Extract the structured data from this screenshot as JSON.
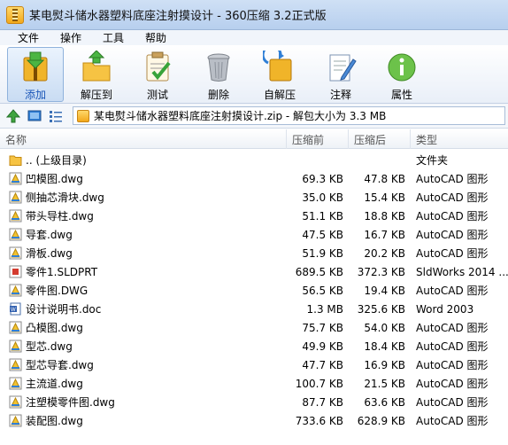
{
  "window": {
    "title": "某电熨斗储水器塑料底座注射摸设计 - 360压缩 3.2正式版"
  },
  "menu": [
    "文件",
    "操作",
    "工具",
    "帮助"
  ],
  "toolbar": {
    "add": "添加",
    "extract": "解压到",
    "test": "测试",
    "delete": "删除",
    "sfx": "自解压",
    "comment": "注释",
    "properties": "属性"
  },
  "address": {
    "path": "某电熨斗储水器塑料底座注射摸设计.zip - 解包大小为 3.3 MB"
  },
  "columns": {
    "name": "名称",
    "compressed": "压缩前",
    "packed": "压缩后",
    "type": "类型"
  },
  "files": [
    {
      "name": ".. (上级目录)",
      "compressed": "",
      "packed": "",
      "type": "文件夹",
      "icon": "folder-icon"
    },
    {
      "name": "凹模图.dwg",
      "compressed": "69.3 KB",
      "packed": "47.8 KB",
      "type": "AutoCAD 图形",
      "icon": "dwg-icon"
    },
    {
      "name": "侧抽芯滑块.dwg",
      "compressed": "35.0 KB",
      "packed": "15.4 KB",
      "type": "AutoCAD 图形",
      "icon": "dwg-icon"
    },
    {
      "name": "带头导柱.dwg",
      "compressed": "51.1 KB",
      "packed": "18.8 KB",
      "type": "AutoCAD 图形",
      "icon": "dwg-icon"
    },
    {
      "name": "导套.dwg",
      "compressed": "47.5 KB",
      "packed": "16.7 KB",
      "type": "AutoCAD 图形",
      "icon": "dwg-icon"
    },
    {
      "name": "滑板.dwg",
      "compressed": "51.9 KB",
      "packed": "20.2 KB",
      "type": "AutoCAD 图形",
      "icon": "dwg-icon"
    },
    {
      "name": "零件1.SLDPRT",
      "compressed": "689.5 KB",
      "packed": "372.3 KB",
      "type": "SldWorks 2014 ...",
      "icon": "sldprt-icon"
    },
    {
      "name": "零件图.DWG",
      "compressed": "56.5 KB",
      "packed": "19.4 KB",
      "type": "AutoCAD 图形",
      "icon": "dwg-icon"
    },
    {
      "name": "设计说明书.doc",
      "compressed": "1.3 MB",
      "packed": "325.6 KB",
      "type": "Word 2003",
      "icon": "doc-icon"
    },
    {
      "name": "凸模图.dwg",
      "compressed": "75.7 KB",
      "packed": "54.0 KB",
      "type": "AutoCAD 图形",
      "icon": "dwg-icon"
    },
    {
      "name": "型芯.dwg",
      "compressed": "49.9 KB",
      "packed": "18.4 KB",
      "type": "AutoCAD 图形",
      "icon": "dwg-icon"
    },
    {
      "name": "型芯导套.dwg",
      "compressed": "47.7 KB",
      "packed": "16.9 KB",
      "type": "AutoCAD 图形",
      "icon": "dwg-icon"
    },
    {
      "name": "主流道.dwg",
      "compressed": "100.7 KB",
      "packed": "21.5 KB",
      "type": "AutoCAD 图形",
      "icon": "dwg-icon"
    },
    {
      "name": "注塑模零件图.dwg",
      "compressed": "87.7 KB",
      "packed": "63.6 KB",
      "type": "AutoCAD 图形",
      "icon": "dwg-icon"
    },
    {
      "name": "装配图.dwg",
      "compressed": "733.6 KB",
      "packed": "628.9 KB",
      "type": "AutoCAD 图形",
      "icon": "dwg-icon"
    }
  ]
}
